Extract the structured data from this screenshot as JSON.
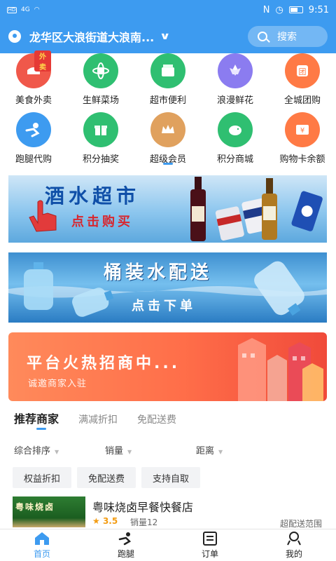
{
  "status_bar": {
    "network": "HD",
    "signal": "4G",
    "time": "9:51"
  },
  "header": {
    "location": "龙华区大浪街道大浪南...",
    "search_label": "搜索"
  },
  "categories": [
    {
      "label": "美食外卖",
      "icon": "takeout-icon",
      "color": "#f0584a",
      "tag": "外卖"
    },
    {
      "label": "生鲜菜场",
      "icon": "fresh-produce-icon",
      "color": "#2fbf71"
    },
    {
      "label": "超市便利",
      "icon": "supermarket-icon",
      "color": "#2fbf71"
    },
    {
      "label": "浪漫鲜花",
      "icon": "flower-icon",
      "color": "#8b7cf0"
    },
    {
      "label": "全城团购",
      "icon": "group-buy-icon",
      "color": "#ff7a45"
    },
    {
      "label": "跑腿代购",
      "icon": "errand-icon",
      "color": "#3d9bf0"
    },
    {
      "label": "积分抽奖",
      "icon": "gift-icon",
      "color": "#2fbf71"
    },
    {
      "label": "超级会员",
      "icon": "crown-icon",
      "color": "#e0a15e"
    },
    {
      "label": "积分商城",
      "icon": "piggy-bank-icon",
      "color": "#2fbf71"
    },
    {
      "label": "购物卡余额",
      "icon": "card-balance-icon",
      "color": "#ff7a45"
    }
  ],
  "banners": {
    "liquor": {
      "title": "酒水超市",
      "cta": "点击购买"
    },
    "water": {
      "title": "桶装水配送",
      "cta": "点击下单"
    },
    "merchant": {
      "title": "平台火热招商中...",
      "subtitle": "诚邀商家入驻"
    }
  },
  "filter_tabs": [
    "推荐商家",
    "满减折扣",
    "免配送费"
  ],
  "sorts": [
    "综合排序",
    "销量",
    "距离"
  ],
  "chips": [
    "权益折扣",
    "免配送费",
    "支持自取"
  ],
  "shop": {
    "name": "粤味烧卤早餐快餐店",
    "sign_text": "粤味烧卤",
    "rating": "3.5",
    "sales": "销量12",
    "range_note": "超配送范围"
  },
  "bottom_nav": [
    {
      "label": "首页",
      "icon": "home-icon",
      "active": true
    },
    {
      "label": "跑腿",
      "icon": "errand-run-icon",
      "active": false
    },
    {
      "label": "订单",
      "icon": "order-icon",
      "active": false
    },
    {
      "label": "我的",
      "icon": "profile-icon",
      "active": false
    }
  ],
  "colors": {
    "primary": "#3d9bf0"
  }
}
